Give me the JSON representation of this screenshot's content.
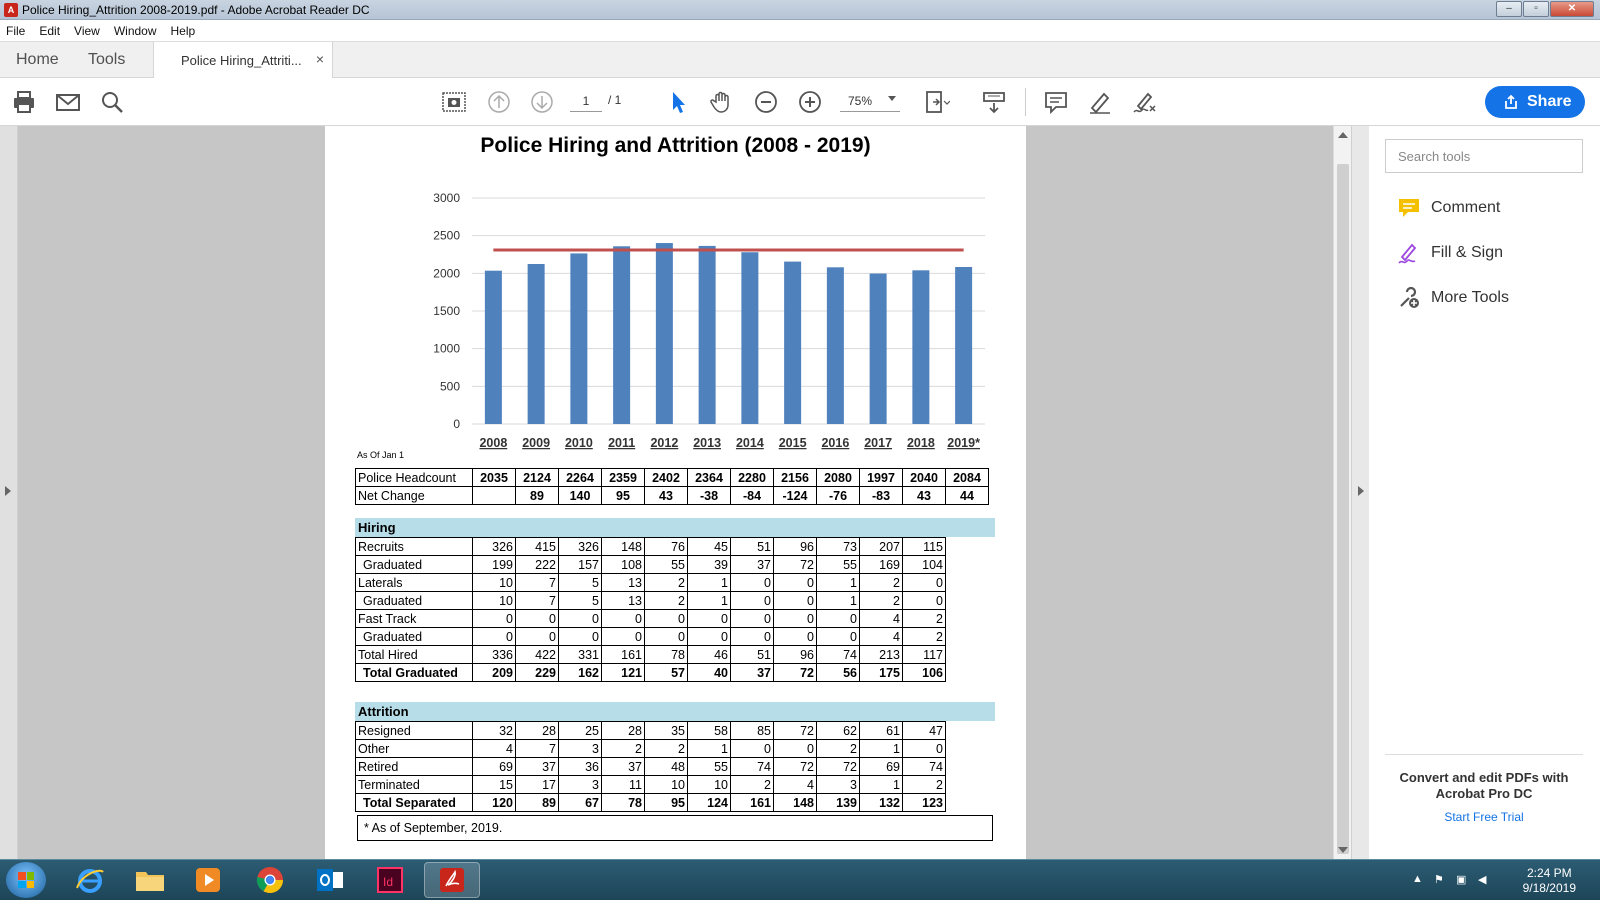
{
  "window": {
    "title": "Police Hiring_Attrition 2008-2019.pdf - Adobe Acrobat Reader DC",
    "min": "‒",
    "max": "▫",
    "close": "✕"
  },
  "menu": [
    "File",
    "Edit",
    "View",
    "Window",
    "Help"
  ],
  "tabs": {
    "home": "Home",
    "tools": "Tools",
    "document": "Police Hiring_Attriti...",
    "close": "×"
  },
  "toolbar": {
    "page_current": "1",
    "page_total": "/ 1",
    "zoom": "75%",
    "share_label": "Share"
  },
  "document": {
    "title": "Police Hiring and Attrition (2008 - 2019)",
    "as_of_label": "As Of Jan 1",
    "headcount_table": {
      "rows": [
        {
          "label": "Police Headcount",
          "values": [
            "2035",
            "2124",
            "2264",
            "2359",
            "2402",
            "2364",
            "2280",
            "2156",
            "2080",
            "1997",
            "2040",
            "2084"
          ]
        },
        {
          "label": "Net Change",
          "values": [
            "",
            "89",
            "140",
            "95",
            "43",
            "-38",
            "-84",
            "-124",
            "-76",
            "-83",
            "43",
            "44"
          ]
        }
      ]
    },
    "hiring": {
      "heading": "Hiring",
      "rows": [
        {
          "label": "Recruits",
          "indent": false,
          "bold": false,
          "values": [
            "326",
            "415",
            "326",
            "148",
            "76",
            "45",
            "51",
            "96",
            "73",
            "207",
            "115"
          ]
        },
        {
          "label": "Graduated",
          "indent": true,
          "bold": false,
          "values": [
            "199",
            "222",
            "157",
            "108",
            "55",
            "39",
            "37",
            "72",
            "55",
            "169",
            "104"
          ]
        },
        {
          "label": "Laterals",
          "indent": false,
          "bold": false,
          "values": [
            "10",
            "7",
            "5",
            "13",
            "2",
            "1",
            "0",
            "0",
            "1",
            "2",
            "0"
          ]
        },
        {
          "label": "Graduated",
          "indent": true,
          "bold": false,
          "values": [
            "10",
            "7",
            "5",
            "13",
            "2",
            "1",
            "0",
            "0",
            "1",
            "2",
            "0"
          ]
        },
        {
          "label": "Fast Track",
          "indent": false,
          "bold": false,
          "values": [
            "0",
            "0",
            "0",
            "0",
            "0",
            "0",
            "0",
            "0",
            "0",
            "4",
            "2"
          ]
        },
        {
          "label": "Graduated",
          "indent": true,
          "bold": false,
          "values": [
            "0",
            "0",
            "0",
            "0",
            "0",
            "0",
            "0",
            "0",
            "0",
            "4",
            "2"
          ]
        },
        {
          "label": "Total Hired",
          "indent": false,
          "bold": false,
          "values": [
            "336",
            "422",
            "331",
            "161",
            "78",
            "46",
            "51",
            "96",
            "74",
            "213",
            "117"
          ]
        },
        {
          "label": "Total Graduated",
          "indent": true,
          "bold": true,
          "values": [
            "209",
            "229",
            "162",
            "121",
            "57",
            "40",
            "37",
            "72",
            "56",
            "175",
            "106"
          ]
        }
      ]
    },
    "attrition": {
      "heading": "Attrition",
      "rows": [
        {
          "label": "Resigned",
          "indent": false,
          "bold": false,
          "values": [
            "32",
            "28",
            "25",
            "28",
            "35",
            "58",
            "85",
            "72",
            "62",
            "61",
            "47"
          ]
        },
        {
          "label": "Other",
          "indent": false,
          "bold": false,
          "values": [
            "4",
            "7",
            "3",
            "2",
            "2",
            "1",
            "0",
            "0",
            "2",
            "1",
            "0"
          ]
        },
        {
          "label": "Retired",
          "indent": false,
          "bold": false,
          "values": [
            "69",
            "37",
            "36",
            "37",
            "48",
            "55",
            "74",
            "72",
            "72",
            "69",
            "74"
          ]
        },
        {
          "label": "Terminated",
          "indent": false,
          "bold": false,
          "values": [
            "15",
            "17",
            "3",
            "11",
            "10",
            "10",
            "2",
            "4",
            "3",
            "1",
            "2"
          ]
        },
        {
          "label": "Total Separated",
          "indent": true,
          "bold": true,
          "values": [
            "120",
            "89",
            "67",
            "78",
            "95",
            "124",
            "161",
            "148",
            "139",
            "132",
            "123"
          ]
        }
      ]
    },
    "footnote": "* As of September, 2019."
  },
  "chart_data": {
    "type": "bar",
    "title": "Police Hiring and Attrition (2008 - 2019)",
    "categories": [
      "2008",
      "2009",
      "2010",
      "2011",
      "2012",
      "2013",
      "2014",
      "2015",
      "2016",
      "2017",
      "2018",
      "2019*"
    ],
    "series": [
      {
        "name": "Police Headcount",
        "type": "bar",
        "color": "#4f81bd",
        "values": [
          2035,
          2124,
          2264,
          2359,
          2402,
          2364,
          2280,
          2156,
          2080,
          1997,
          2040,
          2084
        ]
      },
      {
        "type": "line",
        "color": "#c0504d",
        "values": [
          2310,
          2310,
          2310,
          2310,
          2310,
          2310,
          2310,
          2310,
          2310,
          2310,
          2310,
          2310
        ]
      }
    ],
    "yticks": [
      0,
      500,
      1000,
      1500,
      2000,
      2500,
      3000
    ],
    "ylim": [
      0,
      3000
    ],
    "grid": true,
    "legend": "none"
  },
  "tools_pane": {
    "search_placeholder": "Search tools",
    "items": [
      {
        "label": "Comment",
        "icon": "comment-icon"
      },
      {
        "label": "Fill & Sign",
        "icon": "fill-sign-icon"
      },
      {
        "label": "More Tools",
        "icon": "more-tools-icon"
      }
    ],
    "promo": "Convert and edit PDFs with Acrobat Pro DC",
    "trial_link": "Start Free Trial"
  },
  "taskbar": {
    "apps": [
      "internet-explorer",
      "file-explorer",
      "media-player",
      "chrome",
      "outlook",
      "indesign",
      "acrobat-reader"
    ],
    "time": "2:24 PM",
    "date": "9/18/2019"
  },
  "colors": {
    "accent": "#1473e6",
    "bar": "#4f81bd",
    "target_line": "#c0504d",
    "section_header": "#b7dde8"
  }
}
